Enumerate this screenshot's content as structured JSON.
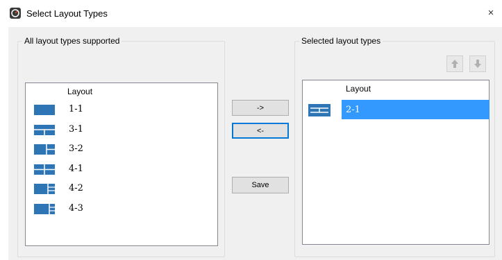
{
  "window": {
    "title": "Select Layout Types",
    "close_glyph": "×"
  },
  "left_group": {
    "label": "All layout types supported",
    "column_header": "Layout",
    "items": [
      {
        "label": "1-1",
        "icon": "layout-1-1-icon"
      },
      {
        "label": "3-1",
        "icon": "layout-3-1-icon"
      },
      {
        "label": "3-2",
        "icon": "layout-3-2-icon"
      },
      {
        "label": "4-1",
        "icon": "layout-4-1-icon"
      },
      {
        "label": "4-2",
        "icon": "layout-4-2-icon"
      },
      {
        "label": "4-3",
        "icon": "layout-4-3-icon"
      }
    ]
  },
  "buttons": {
    "add": "->",
    "remove": "<-",
    "save": "Save"
  },
  "right_group": {
    "label": "Selected layout types",
    "column_header": "Layout",
    "items": [
      {
        "label": "2-1",
        "icon": "layout-2-1-icon",
        "selected": true
      }
    ],
    "move_up_icon": "arrow-up-icon",
    "move_down_icon": "arrow-down-icon"
  },
  "colors": {
    "icon_blue": "#2e75b6",
    "selection": "#3399ff",
    "default_button_border": "#0078d7"
  }
}
